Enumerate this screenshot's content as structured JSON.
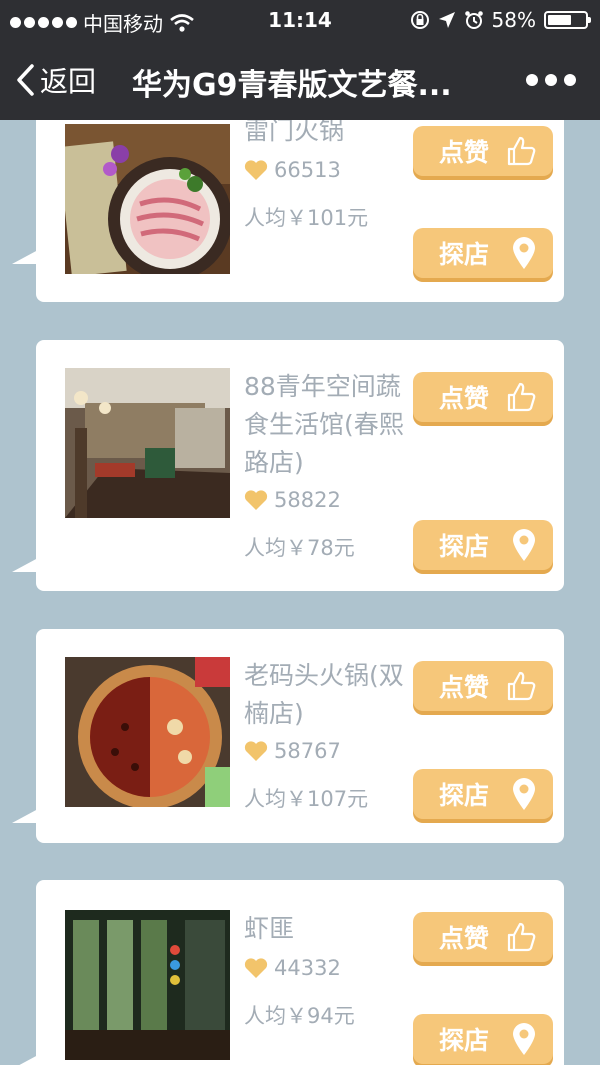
{
  "status_bar": {
    "carrier": "中国移动",
    "time": "11:14",
    "battery": "58%",
    "battery_level": 0.58
  },
  "nav": {
    "back_label": "返回",
    "title": "华为G9青春版文艺餐..."
  },
  "buttons": {
    "like_label": "点赞",
    "visit_label": "探店"
  },
  "restaurants": [
    {
      "name": "雷门火锅",
      "likes": "66513",
      "price": "人均￥101元"
    },
    {
      "name": "88青年空间蔬食生活馆(春熙路店)",
      "likes": "58822",
      "price": "人均￥78元"
    },
    {
      "name": "老码头火锅(双楠店)",
      "likes": "58767",
      "price": "人均￥107元"
    },
    {
      "name": "虾匪",
      "likes": "44332",
      "price": "人均￥94元"
    }
  ],
  "colors": {
    "background": "#aec3ce",
    "bar": "#2e2f33",
    "button": "#f6c77a",
    "button_shadow": "#e4a94f",
    "heart": "#f2c46b",
    "muted_text": "#a3acb5"
  }
}
